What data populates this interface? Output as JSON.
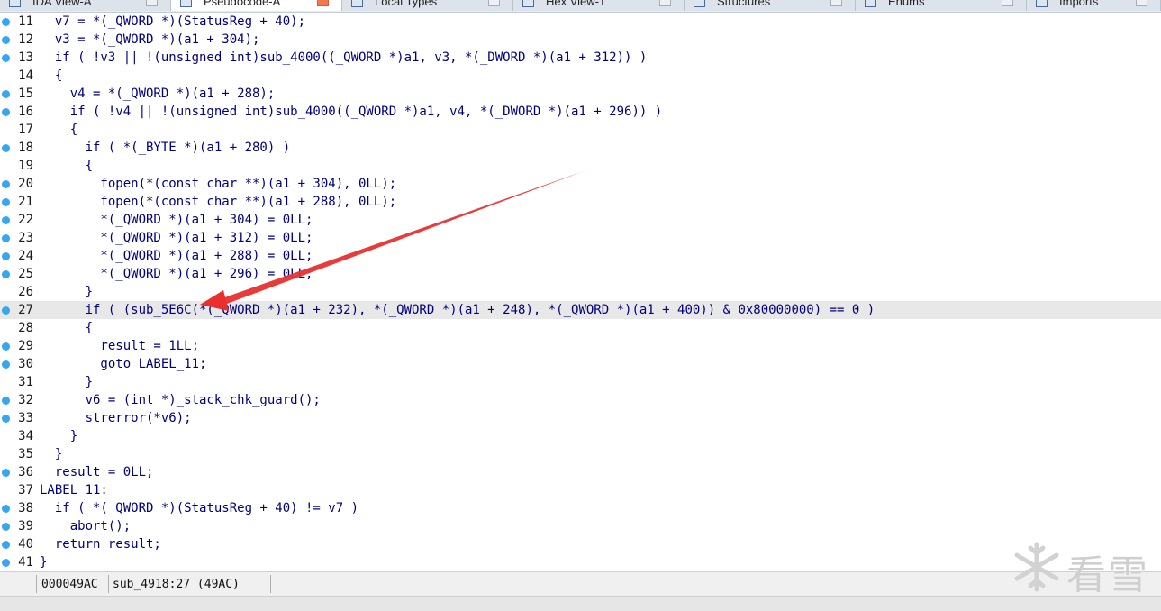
{
  "tabs": [
    {
      "label": "IDA View-A",
      "active": false
    },
    {
      "label": "Pseudocode-A",
      "active": true
    },
    {
      "label": "Local Types",
      "active": false
    },
    {
      "label": "Hex View-1",
      "active": false
    },
    {
      "label": "Structures",
      "active": false
    },
    {
      "label": "Enums",
      "active": false
    },
    {
      "label": "Imports",
      "active": false
    }
  ],
  "code": {
    "highlighted_line": 27,
    "lines": [
      {
        "num": "11",
        "marker": true,
        "text": "  v7 = *(_QWORD *)(StatusReg + 40);"
      },
      {
        "num": "12",
        "marker": true,
        "text": "  v3 = *(_QWORD *)(a1 + 304);"
      },
      {
        "num": "13",
        "marker": true,
        "text": "  if ( !v3 || !(unsigned int)sub_4000((_QWORD *)a1, v3, *(_DWORD *)(a1 + 312)) )"
      },
      {
        "num": "14",
        "marker": false,
        "text": "  {"
      },
      {
        "num": "15",
        "marker": true,
        "text": "    v4 = *(_QWORD *)(a1 + 288);"
      },
      {
        "num": "16",
        "marker": true,
        "text": "    if ( !v4 || !(unsigned int)sub_4000((_QWORD *)a1, v4, *(_DWORD *)(a1 + 296)) )"
      },
      {
        "num": "17",
        "marker": false,
        "text": "    {"
      },
      {
        "num": "18",
        "marker": true,
        "text": "      if ( *(_BYTE *)(a1 + 280) )"
      },
      {
        "num": "19",
        "marker": false,
        "text": "      {"
      },
      {
        "num": "20",
        "marker": true,
        "text": "        fopen(*(const char **)(a1 + 304), 0LL);"
      },
      {
        "num": "21",
        "marker": true,
        "text": "        fopen(*(const char **)(a1 + 288), 0LL);"
      },
      {
        "num": "22",
        "marker": true,
        "text": "        *(_QWORD *)(a1 + 304) = 0LL;"
      },
      {
        "num": "23",
        "marker": true,
        "text": "        *(_QWORD *)(a1 + 312) = 0LL;"
      },
      {
        "num": "24",
        "marker": true,
        "text": "        *(_QWORD *)(a1 + 288) = 0LL;"
      },
      {
        "num": "25",
        "marker": true,
        "text": "        *(_QWORD *)(a1 + 296) = 0LL;"
      },
      {
        "num": "26",
        "marker": false,
        "text": "      }"
      },
      {
        "num": "27",
        "marker": true,
        "text": "      if ( (sub_5E6C(*(_QWORD *)(a1 + 232), *(_QWORD *)(a1 + 248), *(_QWORD *)(a1 + 400)) & 0x80000000) == 0 )"
      },
      {
        "num": "28",
        "marker": false,
        "text": "      {"
      },
      {
        "num": "29",
        "marker": true,
        "text": "        result = 1LL;"
      },
      {
        "num": "30",
        "marker": true,
        "text": "        goto LABEL_11;"
      },
      {
        "num": "31",
        "marker": false,
        "text": "      }"
      },
      {
        "num": "32",
        "marker": true,
        "text": "      v6 = (int *)_stack_chk_guard();"
      },
      {
        "num": "33",
        "marker": true,
        "text": "      strerror(*v6);"
      },
      {
        "num": "34",
        "marker": false,
        "text": "    }"
      },
      {
        "num": "35",
        "marker": false,
        "text": "  }"
      },
      {
        "num": "36",
        "marker": true,
        "text": "  result = 0LL;"
      },
      {
        "num": "37",
        "marker": false,
        "text": "LABEL_11:"
      },
      {
        "num": "38",
        "marker": true,
        "text": "  if ( *(_QWORD *)(StatusReg + 40) != v7 )"
      },
      {
        "num": "39",
        "marker": true,
        "text": "    abort();"
      },
      {
        "num": "40",
        "marker": true,
        "text": "  return result;"
      },
      {
        "num": "41",
        "marker": true,
        "text": "}"
      }
    ]
  },
  "status": {
    "address": "000049AC",
    "location": "sub_4918:27 (49AC)"
  },
  "watermark": {
    "text": "看雪"
  },
  "colors": {
    "marker": "#35a7f0",
    "arrow": "#e8312f",
    "code_text": "#000080",
    "highlight": "#e8e8e8"
  },
  "annotation": {
    "icon": "red-arrow-icon"
  }
}
